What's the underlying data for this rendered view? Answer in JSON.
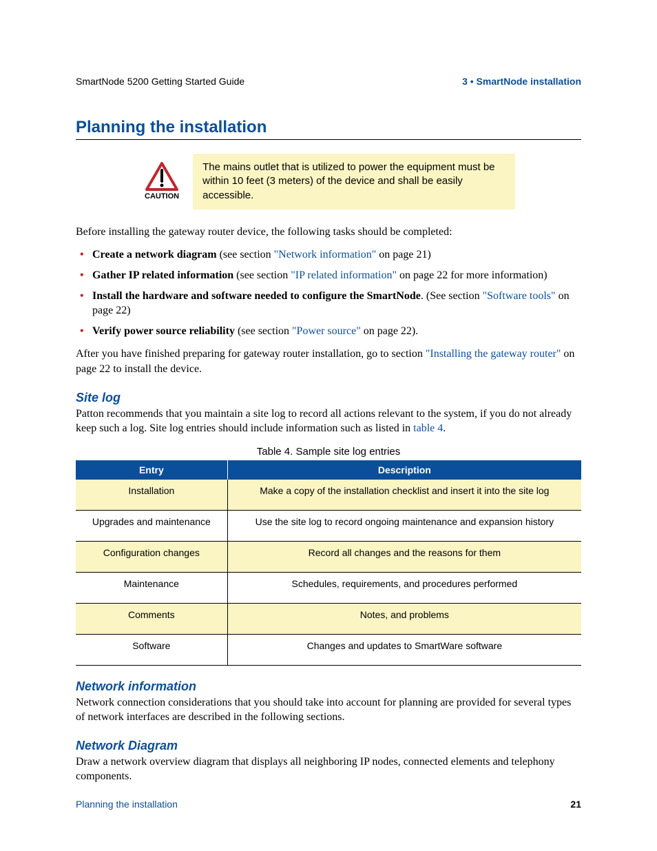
{
  "header": {
    "left": "SmartNode 5200 Getting Started Guide",
    "right": "3 • SmartNode installation"
  },
  "title": "Planning the installation",
  "caution": {
    "label": "CAUTION",
    "text": "The mains outlet that is utilized to power the equipment must be within 10 feet (3 meters) of the device and shall be easily accessible."
  },
  "intro": "Before installing the gateway router device, the following tasks should be completed:",
  "tasks": [
    {
      "bold": "Create a network diagram",
      "mid1": " (see section ",
      "link": "\"Network information\"",
      "mid2": " on page 21)"
    },
    {
      "bold": "Gather IP related information",
      "mid1": " (see section ",
      "link": "\"IP related information\"",
      "mid2": " on page 22 for more information)"
    },
    {
      "bold": "Install the hardware and software needed to configure the SmartNode",
      "mid1": ". (See section ",
      "link": "\"Software tools\"",
      "mid2": " on page 22)"
    },
    {
      "bold": "Verify power source reliability",
      "mid1": " (see section ",
      "link": "\"Power source\"",
      "mid2": " on page 22)."
    }
  ],
  "after_tasks": {
    "pre": "After you have finished preparing for gateway router installation, go to section ",
    "link": "\"Installing the gateway router\"",
    "post": " on page 22 to install the device."
  },
  "sitelog": {
    "heading": "Site log",
    "para_pre": "Patton recommends that you maintain a site log to record all actions relevant to the system, if you do not already keep such a log. Site log entries should include information such as listed in ",
    "para_link": "table 4",
    "para_post": ".",
    "caption": "Table 4. Sample site log entries",
    "headers": {
      "c1": "Entry",
      "c2": "Description"
    },
    "rows": [
      {
        "c1": "Installation",
        "c2": "Make a copy of the installation checklist and insert it into the site log"
      },
      {
        "c1": "Upgrades and maintenance",
        "c2": "Use the site log to record ongoing maintenance and expansion history"
      },
      {
        "c1": "Configuration changes",
        "c2": "Record all changes and the reasons for them"
      },
      {
        "c1": "Maintenance",
        "c2": "Schedules, requirements, and procedures performed"
      },
      {
        "c1": "Comments",
        "c2": "Notes, and problems"
      },
      {
        "c1": "Software",
        "c2": "Changes and updates to SmartWare software"
      }
    ]
  },
  "netinfo": {
    "heading": "Network information",
    "text": "Network connection considerations that you should take into account for planning are provided for several types of network interfaces are described in the following sections."
  },
  "netdiag": {
    "heading": "Network Diagram",
    "text": "Draw a network overview diagram that displays all neighboring IP nodes, connected elements and telephony components."
  },
  "footer": {
    "left": "Planning the installation",
    "right": "21"
  }
}
